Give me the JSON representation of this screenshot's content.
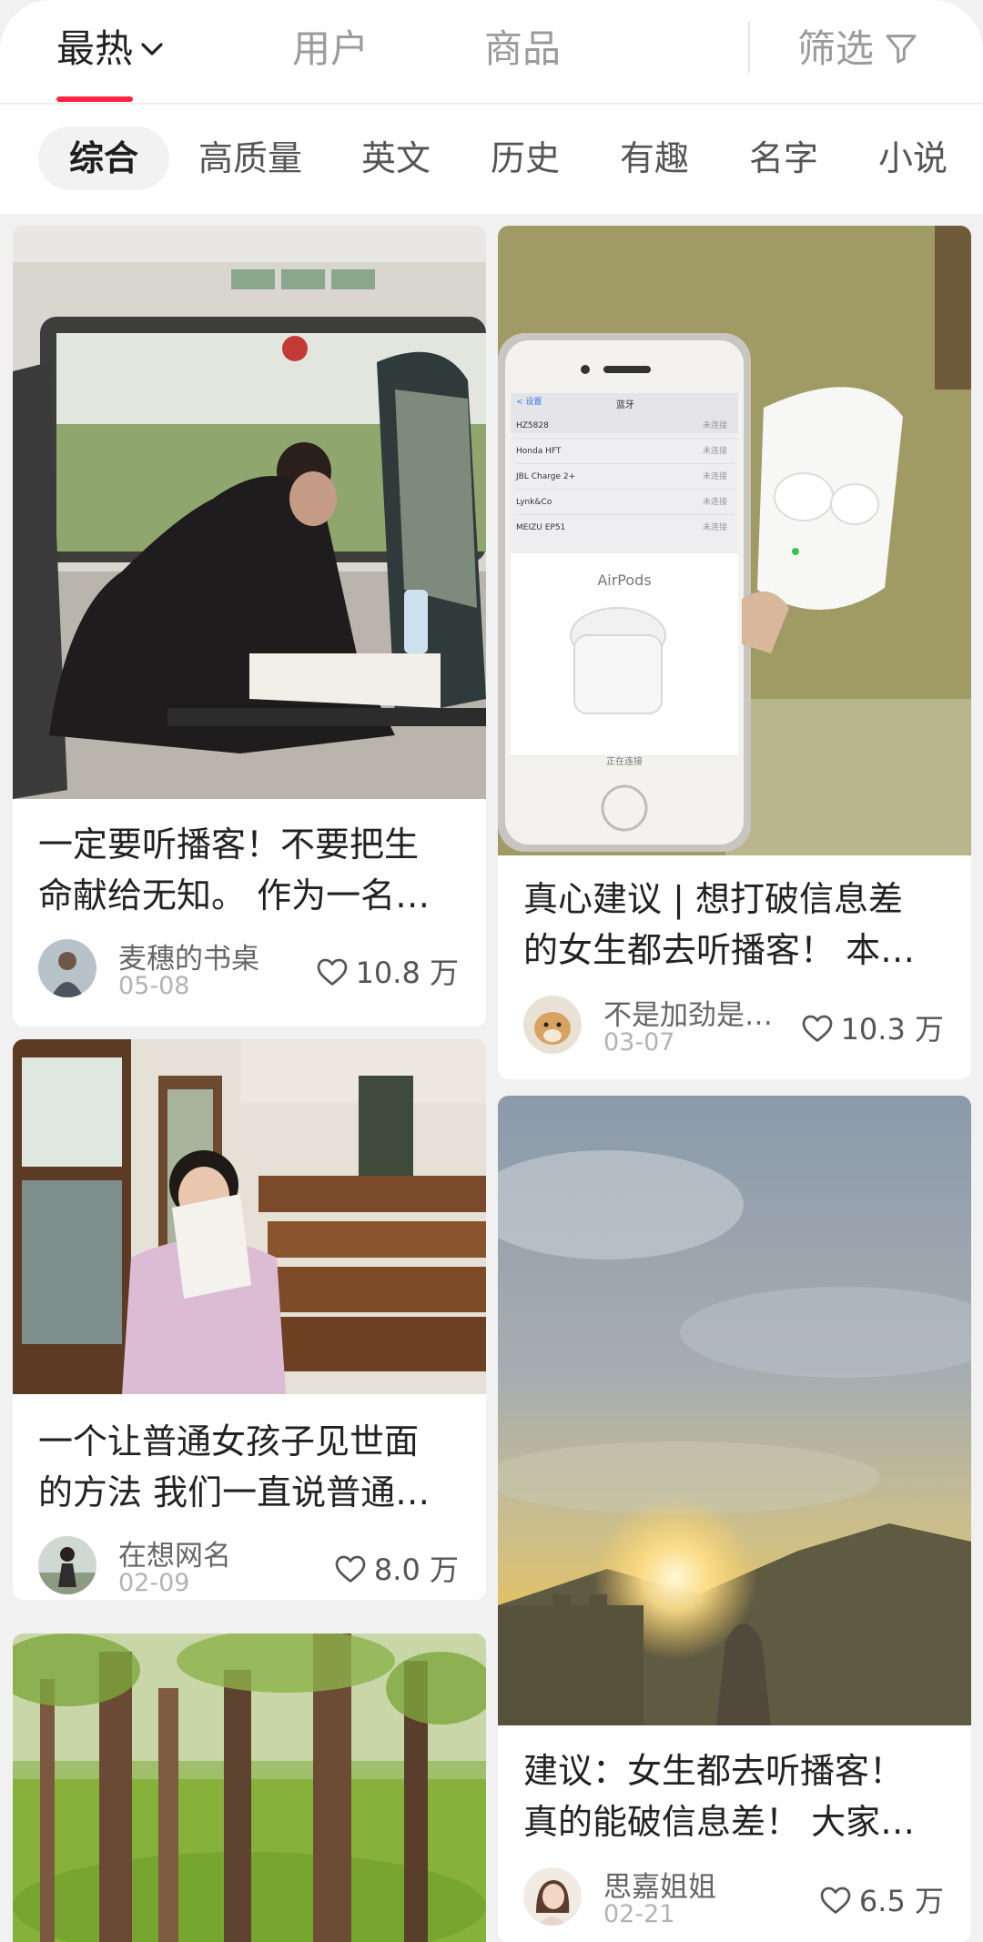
{
  "top_tabs": [
    {
      "label": "最热"
    },
    {
      "label": "用户"
    },
    {
      "label": "商品"
    }
  ],
  "filter_label": "筛选",
  "chips": [
    "综合",
    "高质量",
    "英文",
    "历史",
    "有趣",
    "名字",
    "小说"
  ],
  "cards": [
    {
      "title_line1": "一定要听播客！不要把生",
      "title_line2": "命献给无知。 作为一名…",
      "author": "麦穗的书桌",
      "date": "05-08",
      "likes": "10.8 万"
    },
    {
      "title_line1": "真心建议 | 想打破信息差",
      "title_line2": "的女生都去听播客！ 本…",
      "author": "不是加劲是…",
      "date": "03-07",
      "likes": "10.3 万",
      "phone_screen": {
        "back_label": "< 设置",
        "header": "蓝牙",
        "devices": [
          "HZ5828",
          "Honda HFT",
          "JBL Charge 2+",
          "Lynk&Co",
          "MEIZU EP51"
        ],
        "device_status": "未连接",
        "popup_title": "AirPods",
        "popup_status": "正在连接"
      }
    },
    {
      "title_line1": "一个让普通女孩子见世面",
      "title_line2": "的方法 我们一直说普通…",
      "author": "在想网名",
      "date": "02-09",
      "likes": "8.0 万"
    },
    {
      "title_line1": "建议：女生都去听播客！",
      "title_line2": "真的能破信息差！ 大家…",
      "author": "思嘉姐姐",
      "date": "02-21",
      "likes": "6.5 万"
    },
    {}
  ],
  "colors": {
    "accent": "#ff2442",
    "page_bg": "#f1f1f1",
    "card_bg": "#ffffff"
  },
  "icons": {
    "sort_toggle": "chevron-down-icon",
    "filter": "funnel-icon",
    "like": "heart-outline-icon"
  }
}
